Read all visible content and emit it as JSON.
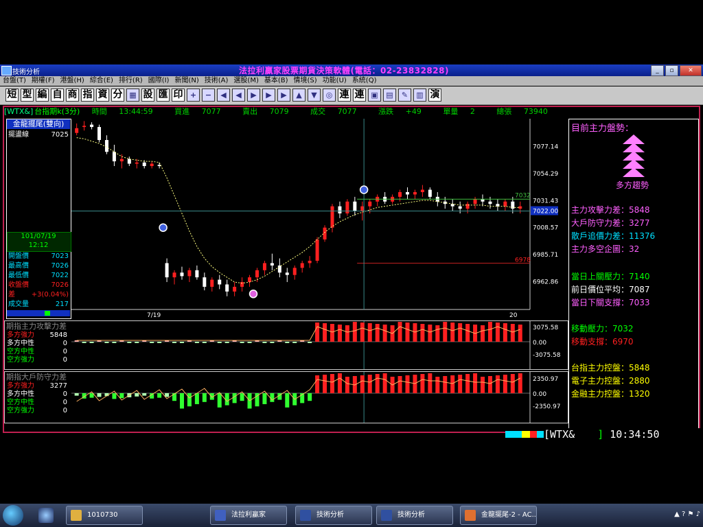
{
  "window": {
    "title": "技術分析",
    "slogan": "法拉利贏家股票期貨決策軟體(電話：02-23832828)"
  },
  "menu": [
    "台盤(T)",
    "期權(F)",
    "港盤(H)",
    "綜合(E)",
    "排行(R)",
    "國際(I)",
    "新聞(N)",
    "技術(A)",
    "選股(M)",
    "基本(B)",
    "情境(S)",
    "功能(U)",
    "系統(Q)"
  ],
  "toolbar": {
    "text_buttons": [
      "短",
      "型",
      "編",
      "自",
      "商",
      "指",
      "資",
      "分"
    ],
    "text_buttons2": [
      "設",
      "匯",
      "印"
    ],
    "text_buttons3": [
      "連",
      "連"
    ],
    "icon_button": "演"
  },
  "infobar": {
    "symbol": "[WTX&]",
    "name": "台指期k(3分)",
    "time_label": "時間",
    "time": "13:44:59",
    "bid_label": "買進",
    "bid": "7077",
    "ask_label": "賣出",
    "ask": "7079",
    "deal_label": "成交",
    "deal": "7077",
    "change_label": "漲跌",
    "change": "+49",
    "vol_label": "單量",
    "vol": "2",
    "total_label": "總張",
    "total": "73940"
  },
  "left_panel": {
    "indicator": "金龍擺尾(雙向)",
    "line_label": "擺盪線",
    "line_value": "7025",
    "date": "101/07/19",
    "time": "12:12",
    "quotes": [
      {
        "k": "開盤價",
        "v": "7023",
        "color": "#00e0ff"
      },
      {
        "k": "最高價",
        "v": "7026",
        "color": "#00e0ff"
      },
      {
        "k": "最低價",
        "v": "7022",
        "color": "#00e0ff"
      },
      {
        "k": "收盤價",
        "v": "7026",
        "color": "#ff2020"
      },
      {
        "k": "差",
        "v": "+3(0.04%)",
        "color": "#ff2020"
      },
      {
        "k": "成交量",
        "v": "217",
        "color": "#00e0ff"
      }
    ]
  },
  "sub1": {
    "title": "期指主力攻擊力差",
    "rows": [
      {
        "k": "多方強力",
        "v": "5848",
        "color": "#ff2020"
      },
      {
        "k": "多方中性",
        "v": "0",
        "color": "#ffffff"
      },
      {
        "k": "空方中性",
        "v": "0",
        "color": "#00ff00"
      },
      {
        "k": "空方強力",
        "v": "0",
        "color": "#00ff00"
      }
    ],
    "ticks": [
      "3075.58",
      "0.00",
      "-3075.58"
    ]
  },
  "sub2": {
    "title": "期指大戶防守力差",
    "rows": [
      {
        "k": "多方強力",
        "v": "3277",
        "color": "#ff2020"
      },
      {
        "k": "多方中性",
        "v": "0",
        "color": "#ffffff"
      },
      {
        "k": "空方中性",
        "v": "0",
        "color": "#00ff00"
      },
      {
        "k": "空方強力",
        "v": "0",
        "color": "#00ff00"
      }
    ],
    "ticks": [
      "2350.97",
      "0.00",
      "-2350.97"
    ]
  },
  "right_panel": {
    "heading": "目前主力盤勢：",
    "trend": "多方趨勢",
    "lines": [
      {
        "text": "主力攻擊力差：5848",
        "color": "#ff60ff"
      },
      {
        "text": "大戶防守力差：3277",
        "color": "#ff60ff"
      },
      {
        "text": "散戶追價力差：11376",
        "color": "#00e0ff"
      },
      {
        "text": "主力多空企圖：32",
        "color": "#ff60ff"
      },
      {
        "text": "當日上關壓力：7140",
        "color": "#00ff00"
      },
      {
        "text": "前日價位平均：7087",
        "color": "#ffffff"
      },
      {
        "text": "當日下關支撐：7033",
        "color": "#ff60ff"
      },
      {
        "text": "移動壓力：7032",
        "color": "#00ff00"
      },
      {
        "text": "移動支撐：6970",
        "color": "#ff2020"
      },
      {
        "text": "台指主力控盤：5848",
        "color": "#ffff00"
      },
      {
        "text": "電子主力控盤：2880",
        "color": "#ffff00"
      },
      {
        "text": "金融主力控盤：1320",
        "color": "#ffff00"
      }
    ]
  },
  "status": {
    "symbol": "[WTX&",
    "clock": "10:34:50"
  },
  "taskbar": {
    "tasks": [
      "1010730",
      "法拉利贏家",
      "技術分析",
      "技術分析",
      "金龍擺尾-2 - AC..."
    ]
  },
  "chart_data": {
    "type": "candlestick",
    "yticks": [
      7077.14,
      7054.29,
      7031.43,
      7008.57,
      6985.71,
      6962.86
    ],
    "xlabels": [
      "7/19",
      "20"
    ],
    "ylim": [
      6940,
      7100
    ],
    "resistance": 7032,
    "support": 6978,
    "crosshair_value": "7022.00",
    "candles": [
      [
        7088,
        7096,
        7086,
        7092
      ],
      [
        7093,
        7098,
        7090,
        7094
      ],
      [
        7095,
        7097,
        7091,
        7093
      ],
      [
        7093,
        7095,
        7080,
        7082
      ],
      [
        7082,
        7086,
        7070,
        7072
      ],
      [
        7072,
        7078,
        7060,
        7064
      ],
      [
        7064,
        7070,
        7058,
        7066
      ],
      [
        7066,
        7068,
        7060,
        7062
      ],
      [
        7062,
        7066,
        7058,
        7063
      ],
      [
        7063,
        7065,
        7058,
        7060
      ],
      [
        7060,
        7064,
        7058,
        7062
      ],
      [
        7061,
        7063,
        7058,
        7060
      ],
      [
        6978,
        6982,
        6962,
        6966
      ],
      [
        6966,
        6972,
        6960,
        6970
      ],
      [
        6970,
        6975,
        6964,
        6967
      ],
      [
        6967,
        6974,
        6962,
        6972
      ],
      [
        6972,
        6976,
        6964,
        6966
      ],
      [
        6966,
        6970,
        6955,
        6958
      ],
      [
        6958,
        6966,
        6954,
        6964
      ],
      [
        6964,
        6968,
        6956,
        6960
      ],
      [
        6960,
        6964,
        6950,
        6954
      ],
      [
        6954,
        6962,
        6950,
        6958
      ],
      [
        6958,
        6966,
        6954,
        6962
      ],
      [
        6962,
        6968,
        6958,
        6966
      ],
      [
        6966,
        6974,
        6962,
        6972
      ],
      [
        6972,
        6980,
        6968,
        6978
      ],
      [
        6978,
        6986,
        6972,
        6976
      ],
      [
        6976,
        6982,
        6966,
        6970
      ],
      [
        6970,
        6974,
        6962,
        6968
      ],
      [
        6968,
        6976,
        6964,
        6974
      ],
      [
        6974,
        6980,
        6970,
        6978
      ],
      [
        6978,
        6984,
        6974,
        6980
      ],
      [
        6980,
        7000,
        6978,
        6998
      ],
      [
        6998,
        7010,
        6996,
        7008
      ],
      [
        7008,
        7028,
        7004,
        7026
      ],
      [
        7026,
        7030,
        7016,
        7020
      ],
      [
        7020,
        7032,
        7018,
        7030
      ],
      [
        7030,
        7034,
        7018,
        7022
      ],
      [
        7022,
        7030,
        7014,
        7026
      ],
      [
        7026,
        7032,
        7020,
        7030
      ],
      [
        7030,
        7036,
        7026,
        7034
      ],
      [
        7034,
        7038,
        7028,
        7030
      ],
      [
        7030,
        7036,
        7028,
        7034
      ],
      [
        7034,
        7040,
        7030,
        7038
      ],
      [
        7038,
        7042,
        7032,
        7036
      ],
      [
        7036,
        7040,
        7032,
        7038
      ],
      [
        7038,
        7044,
        7034,
        7040
      ],
      [
        7040,
        7042,
        7032,
        7034
      ],
      [
        7034,
        7038,
        7026,
        7030
      ],
      [
        7030,
        7034,
        7024,
        7028
      ],
      [
        7028,
        7032,
        7022,
        7026
      ],
      [
        7026,
        7030,
        7020,
        7024
      ],
      [
        7024,
        7030,
        7020,
        7028
      ],
      [
        7028,
        7034,
        7024,
        7032
      ],
      [
        7032,
        7036,
        7026,
        7030
      ],
      [
        7030,
        7034,
        7024,
        7028
      ],
      [
        7028,
        7032,
        7022,
        7026
      ],
      [
        7026,
        7032,
        7022,
        7030
      ],
      [
        7030,
        7034,
        7020,
        7024
      ],
      [
        7024,
        7030,
        7020,
        7026
      ]
    ],
    "ma": [
      7084,
      7083,
      7081,
      7079,
      7076,
      7072,
      7068,
      7066,
      7065,
      7064,
      7064,
      7063,
      7050,
      7035,
      7020,
      7005,
      6992,
      6982,
      6975,
      6970,
      6966,
      6962,
      6961,
      6962,
      6964,
      6967,
      6971,
      6975,
      6979,
      6983,
      6987,
      6992,
      6998,
      7004,
      7009,
      7013,
      7016,
      7019,
      7021,
      7023,
      7025,
      7026,
      7027,
      7028,
      7029,
      7030,
      7031,
      7031,
      7030,
      7029,
      7028,
      7027,
      7027,
      7027,
      7027,
      7026,
      7026,
      7026,
      7025,
      7025
    ]
  }
}
